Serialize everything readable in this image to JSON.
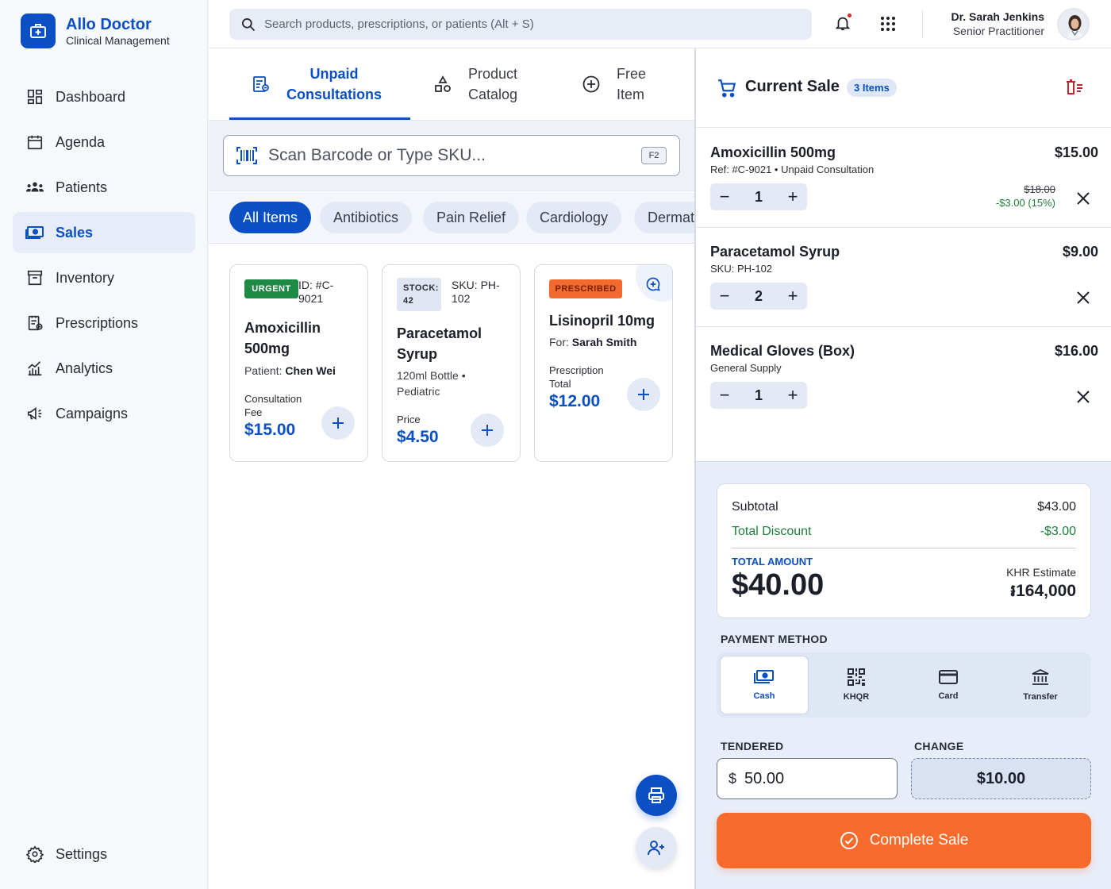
{
  "brand": {
    "title": "Allo Doctor",
    "subtitle": "Clinical Management"
  },
  "nav": {
    "items": [
      {
        "label": "Dashboard",
        "icon": "dashboard-icon"
      },
      {
        "label": "Agenda",
        "icon": "calendar-icon"
      },
      {
        "label": "Patients",
        "icon": "patients-icon"
      },
      {
        "label": "Sales",
        "icon": "cash-icon",
        "active": true
      },
      {
        "label": "Inventory",
        "icon": "inventory-icon"
      },
      {
        "label": "Prescriptions",
        "icon": "prescription-icon"
      },
      {
        "label": "Analytics",
        "icon": "analytics-icon"
      },
      {
        "label": "Campaigns",
        "icon": "megaphone-icon"
      }
    ],
    "settings": "Settings"
  },
  "topbar": {
    "search_placeholder": "Search products, prescriptions, or patients (Alt + S)",
    "user_name": "Dr. Sarah Jenkins",
    "user_role": "Senior Practitioner"
  },
  "tabs": {
    "unpaid_line1": "Unpaid",
    "unpaid_line2": "Consultations",
    "catalog_line1": "Product",
    "catalog_line2": "Catalog",
    "free_line1": "Free",
    "free_line2": "Item"
  },
  "scan": {
    "placeholder": "Scan Barcode or Type SKU...",
    "shortcut": "F2"
  },
  "filters": [
    "All Items",
    "Antibiotics",
    "Pain Relief",
    "Cardiology",
    "Dermatology"
  ],
  "cards": {
    "c1": {
      "badge": "URGENT",
      "id_line1": "ID: #C-",
      "id_line2": "9021",
      "title_line1": "Amoxicillin",
      "title_line2": "500mg",
      "patient_prefix": "Patient:",
      "patient": "Chen Wei",
      "label_line1": "Consultation",
      "label_line2": "Fee",
      "price": "$15.00"
    },
    "c2": {
      "badge_line1": "STOCK:",
      "badge_line2": "42",
      "sku_line1": "SKU: PH-",
      "sku_line2": "102",
      "title_line1": "Paracetamol",
      "title_line2": "Syrup",
      "desc_line1": "120ml Bottle •",
      "desc_line2": "Pediatric",
      "label": "Price",
      "price": "$4.50"
    },
    "c3": {
      "badge": "PRESCRIBED",
      "title": "Lisinopril 10mg",
      "for_prefix": "For:",
      "for_name": "Sarah Smith",
      "label_line1": "Prescription",
      "label_line2": "Total",
      "price": "$12.00"
    }
  },
  "cart": {
    "title": "Current Sale",
    "count": "3 Items",
    "lines": [
      {
        "name": "Amoxicillin 500mg",
        "sub": "Ref: #C-9021 • Unpaid Consultation",
        "price": "$15.00",
        "qty": "1",
        "original": "$18.00",
        "discount": "-$3.00 (15%)"
      },
      {
        "name": "Paracetamol Syrup",
        "sub": "SKU: PH-102",
        "price": "$9.00",
        "qty": "2"
      },
      {
        "name": "Medical Gloves (Box)",
        "sub": "General Supply",
        "price": "$16.00",
        "qty": "1"
      }
    ]
  },
  "totals": {
    "subtotal_label": "Subtotal",
    "subtotal": "$43.00",
    "discount_label": "Total Discount",
    "discount": "-$3.00",
    "total_label": "TOTAL AMOUNT",
    "total": "$40.00",
    "khr_label": "KHR Estimate",
    "khr": "៛164,000"
  },
  "payment": {
    "label": "PAYMENT METHOD",
    "methods": [
      "Cash",
      "KHQR",
      "Card",
      "Transfer"
    ],
    "selected": "Cash"
  },
  "tender": {
    "label": "TENDERED",
    "currency": "$",
    "value": "50.00",
    "change_label": "CHANGE",
    "change": "$10.00"
  },
  "complete_label": "Complete Sale",
  "colors": {
    "primary": "#0b4fc4",
    "accent": "#f76b2c",
    "urgent": "#1e8a45",
    "prescribed": "#f26a2e",
    "discount": "#1e7d3a"
  }
}
